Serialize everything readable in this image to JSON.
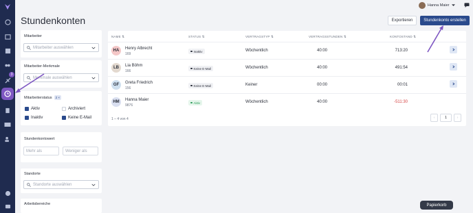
{
  "header": {
    "title": "Stundenkonten",
    "export_label": "Exportieren",
    "create_label": "Stundenkonto erstellen",
    "user_name": "Hanna Maier"
  },
  "sidebar": {
    "badge": "3",
    "accent": "#7e57c2",
    "background": "#1f2b4f"
  },
  "filters": {
    "employee_label": "Mitarbeiter",
    "employee_placeholder": "Mitarbeiter auswählen",
    "attributes_label": "Mitarbeiter-Merkmale",
    "attributes_placeholder": "Merkmale auswählen",
    "status_label": "Mitarbeiterstatus",
    "status_count": "2 ×",
    "status_options": [
      {
        "label": "Aktiv",
        "checked": true
      },
      {
        "label": "Archiviert",
        "checked": false
      },
      {
        "label": "Inaktiv",
        "checked": true
      },
      {
        "label": "Keine E-Mail",
        "checked": true
      }
    ],
    "balance_label": "Stundenkontowert",
    "more_than": "Mehr als",
    "less_than": "Weniger als",
    "locations_label": "Standorte",
    "locations_placeholder": "Standorte auswählen",
    "areas_label": "Arbeitsbereiche"
  },
  "table": {
    "columns": [
      "NAME",
      "STATUS",
      "VERTRAGSTYP",
      "VERTRAGSSTUNDEN",
      "KONTOSTAND"
    ],
    "rows": [
      {
        "initials": "HA",
        "name": "Henry Albrecht",
        "id": "169",
        "status": "Inaktiv",
        "contract": "Wöchentlich",
        "hours": "40:00",
        "balance": "713:20",
        "avatar_color": "#f4c7c7"
      },
      {
        "initials": "LB",
        "name": "Lia Böhm",
        "id": "166",
        "status": "Keine E-Mail",
        "contract": "Wöchentlich",
        "hours": "40:00",
        "balance": "491:54",
        "avatar_color": "#e3d9cf"
      },
      {
        "initials": "GF",
        "name": "Greta Friedrich",
        "id": "156",
        "status": "Keine E-Mail",
        "contract": "Keiner",
        "hours": "00:00",
        "balance": "00:01",
        "avatar_color": "#cfe0ef"
      },
      {
        "initials": "HM",
        "name": "Hanna Maier",
        "id": "9876",
        "status": "Aktiv",
        "contract": "Wöchentlich",
        "hours": "40:00",
        "balance": "-511:30",
        "avatar_color": "#d9dff0"
      }
    ],
    "summary": "1 – 4 von 4",
    "page": "1"
  },
  "trash_label": "Papierkorb"
}
